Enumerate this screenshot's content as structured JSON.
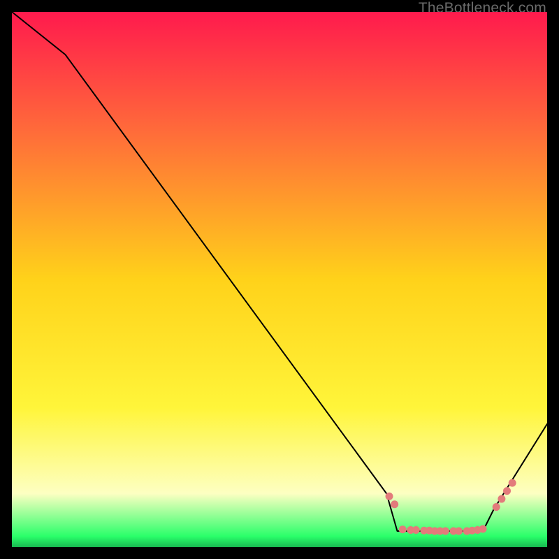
{
  "watermark": "TheBottleneck.com",
  "colors": {
    "grad_top": "#ff1a4d",
    "grad_mid_upper": "#ff6a3a",
    "grad_mid": "#ffd21a",
    "grad_mid_lower": "#fff53a",
    "grad_pale": "#fdffc2",
    "grad_green": "#2aff6a",
    "line": "#000000",
    "dot": "#e37b7b"
  },
  "chart_data": {
    "type": "line",
    "title": "",
    "xlabel": "",
    "ylabel": "",
    "xlim": [
      0,
      100
    ],
    "ylim": [
      0,
      100
    ],
    "series": [
      {
        "name": "bottleneck-curve",
        "x": [
          0,
          10,
          70,
          72,
          88,
          90,
          100
        ],
        "y": [
          100,
          92,
          10,
          3,
          3,
          7,
          23
        ]
      }
    ],
    "markers": {
      "name": "highlight-dots",
      "points": [
        {
          "x": 70.5,
          "y": 9.5
        },
        {
          "x": 71.5,
          "y": 8.0
        },
        {
          "x": 73.0,
          "y": 3.3
        },
        {
          "x": 74.5,
          "y": 3.2
        },
        {
          "x": 75.5,
          "y": 3.2
        },
        {
          "x": 77.0,
          "y": 3.1
        },
        {
          "x": 78.0,
          "y": 3.1
        },
        {
          "x": 79.0,
          "y": 3.0
        },
        {
          "x": 80.0,
          "y": 3.0
        },
        {
          "x": 81.0,
          "y": 3.0
        },
        {
          "x": 82.5,
          "y": 3.0
        },
        {
          "x": 83.5,
          "y": 3.0
        },
        {
          "x": 85.0,
          "y": 3.0
        },
        {
          "x": 86.0,
          "y": 3.1
        },
        {
          "x": 87.0,
          "y": 3.2
        },
        {
          "x": 88.0,
          "y": 3.4
        },
        {
          "x": 90.5,
          "y": 7.5
        },
        {
          "x": 91.5,
          "y": 9.0
        },
        {
          "x": 92.5,
          "y": 10.5
        },
        {
          "x": 93.5,
          "y": 12.0
        }
      ]
    }
  }
}
